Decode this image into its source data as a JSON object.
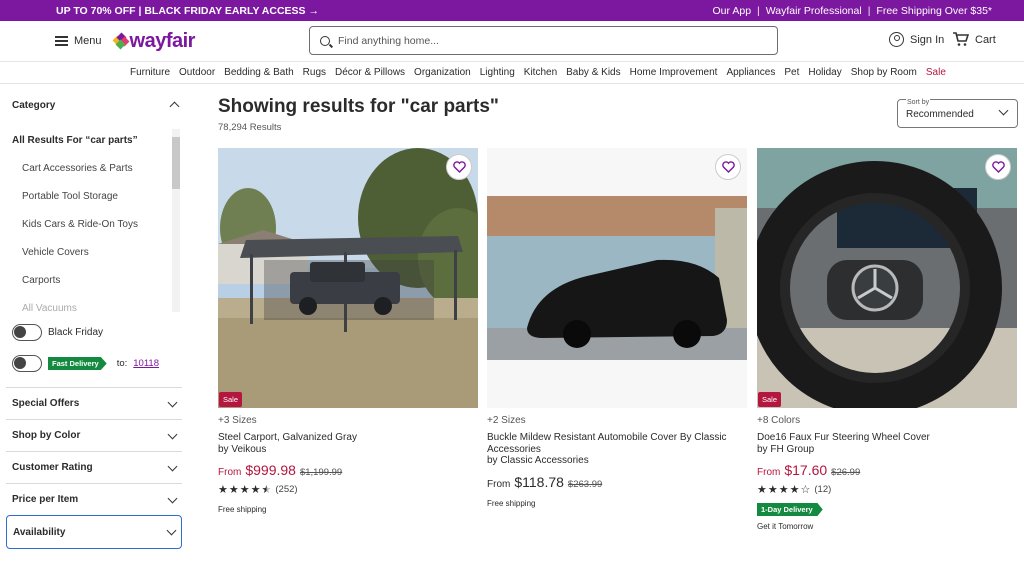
{
  "promo": {
    "left": "UP TO 70% OFF | BLACK FRIDAY EARLY ACCESS →",
    "links": [
      "Our App",
      "Wayfair Professional",
      "Free Shipping Over $35*"
    ]
  },
  "header": {
    "menu_label": "Menu",
    "logo_text": "wayfair",
    "search_placeholder": "Find anything home...",
    "sign_in": "Sign In",
    "cart": "Cart"
  },
  "nav": [
    "Furniture",
    "Outdoor",
    "Bedding & Bath",
    "Rugs",
    "Décor & Pillows",
    "Organization",
    "Lighting",
    "Kitchen",
    "Baby & Kids",
    "Home Improvement",
    "Appliances",
    "Pet",
    "Holiday",
    "Shop by Room",
    "Sale"
  ],
  "sidebar": {
    "category_title": "Category",
    "all_results": "All Results For “car parts”",
    "categories": [
      "Cart Accessories & Parts",
      "Portable Tool Storage",
      "Kids Cars & Ride-On Toys",
      "Vehicle Covers",
      "Carports",
      "All Vacuums"
    ],
    "black_friday": "Black Friday",
    "fast_delivery": "Fast Delivery",
    "to_label": "to:",
    "zip": "10118",
    "filters": [
      "Special Offers",
      "Shop by Color",
      "Customer Rating",
      "Price per Item",
      "Availability"
    ]
  },
  "results": {
    "title": "Showing results for \"car parts\"",
    "count": "78,294 Results",
    "sort_label": "Sort by",
    "sort_value": "Recommended"
  },
  "products": [
    {
      "sizes": "+3 Sizes",
      "name": "Steel Carport, Galvanized Gray",
      "brand": "by Veikous",
      "from": "From",
      "price": "$999.98",
      "was": "$1,199.99",
      "rating": 4.5,
      "reviews": "(252)",
      "shipping": "Free shipping",
      "badge": "Sale"
    },
    {
      "sizes": "+2 Sizes",
      "name": "Buckle Mildew Resistant Automobile Cover By Classic Accessories",
      "brand": "by Classic Accessories",
      "from": "From",
      "price": "$118.78",
      "was": "$263.99",
      "shipping": "Free shipping"
    },
    {
      "sizes": "+8 Colors",
      "name": "Doe16 Faux Fur Steering Wheel Cover",
      "brand": "by FH Group",
      "from": "From",
      "price": "$17.60",
      "was": "$26.99",
      "rating": 4,
      "reviews": "(12)",
      "delivery": "1-Day Delivery",
      "delivery_note": "Get it Tomorrow",
      "badge": "Sale"
    }
  ],
  "colors": {
    "brand": "#7b189f",
    "sale": "#b3163f",
    "fast": "#148a40"
  }
}
